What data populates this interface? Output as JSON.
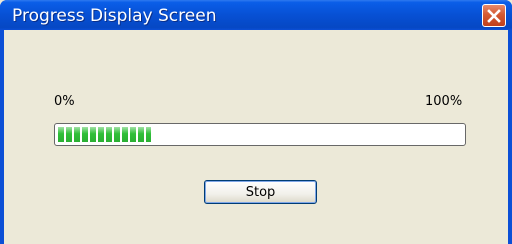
{
  "window": {
    "title": "Progress Display Screen"
  },
  "progress": {
    "start_label": "0%",
    "end_label": "100%",
    "value": 0.23
  },
  "buttons": {
    "stop_label": "Stop"
  },
  "icons": {
    "close": "close-icon"
  },
  "colors": {
    "titlebar": "#0750d4",
    "progress_fill": "#2fbf38",
    "close_button": "#d45a33"
  }
}
